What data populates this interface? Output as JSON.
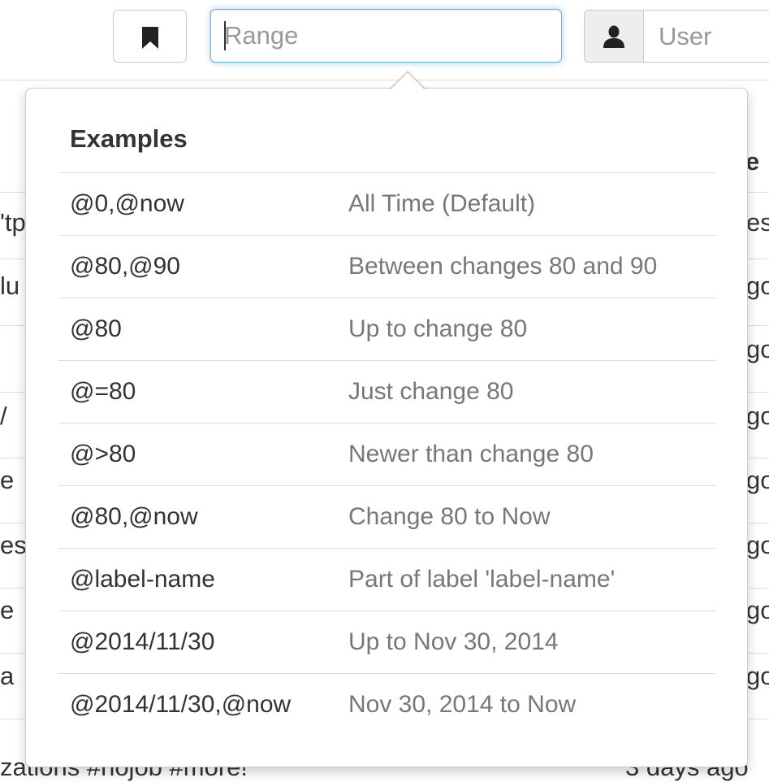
{
  "toolbar": {
    "range_placeholder": "Range",
    "range_value": "",
    "user_placeholder": "User",
    "user_value": "",
    "bookmark_icon": "bookmark-icon",
    "user_icon": "user-icon"
  },
  "popover": {
    "title": "Examples",
    "examples": [
      {
        "code": "@0,@now",
        "description": "All Time (Default)"
      },
      {
        "code": "@80,@90",
        "description": "Between changes 80 and 90"
      },
      {
        "code": "@80",
        "description": "Up to change 80"
      },
      {
        "code": "@=80",
        "description": "Just change 80"
      },
      {
        "code": "@>80",
        "description": "Newer than change 80"
      },
      {
        "code": "@80,@now",
        "description": "Change 80 to Now"
      },
      {
        "code": "@label-name",
        "description": "Part of label 'label-name'"
      },
      {
        "code": "@2014/11/30",
        "description": "Up to Nov 30, 2014"
      },
      {
        "code": "@2014/11/30,@now",
        "description": "Nov 30, 2014 to Now"
      }
    ]
  },
  "background": {
    "header_right": "e",
    "rows": [
      {
        "left": "'tp",
        "right": "es"
      },
      {
        "left": "lu",
        "right": "go"
      },
      {
        "left": "",
        "right": "go"
      },
      {
        "left": "/",
        "right": "go"
      },
      {
        "left": "e",
        "right": "go"
      },
      {
        "left": "es",
        "right": "go"
      },
      {
        "left": "e",
        "right": "go"
      },
      {
        "left": "a",
        "right": "go"
      }
    ],
    "bottom_left": "zations #nojob #more!",
    "bottom_right": "3 days ago"
  },
  "colors": {
    "focus_border": "#66afe9",
    "description_text": "#777777",
    "placeholder_text": "#999999"
  }
}
